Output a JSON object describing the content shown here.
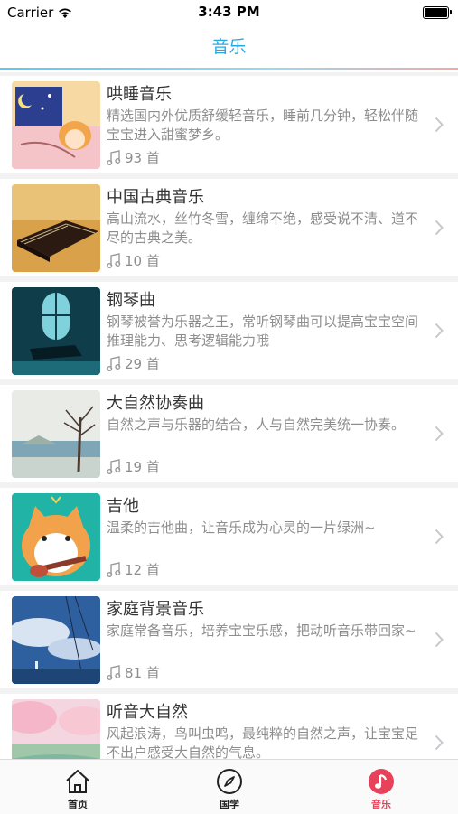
{
  "status": {
    "carrier": "Carrier",
    "time": "3:43 PM"
  },
  "header": {
    "title": "音乐"
  },
  "items": [
    {
      "name": "哄睡音乐",
      "desc": "精选国内外优质舒缓轻音乐，睡前几分钟，轻松伴随宝宝进入甜蜜梦乡。",
      "count": "93 首"
    },
    {
      "name": "中国古典音乐",
      "desc": "高山流水，丝竹冬雪，缠绵不绝，感受说不清、道不尽的古典之美。",
      "count": "10 首"
    },
    {
      "name": "钢琴曲",
      "desc": "钢琴被誉为乐器之王，常听钢琴曲可以提高宝宝空间推理能力、思考逻辑能力哦",
      "count": "29 首"
    },
    {
      "name": "大自然协奏曲",
      "desc": "自然之声与乐器的结合，人与自然完美统一协奏。",
      "count": "19 首"
    },
    {
      "name": "吉他",
      "desc": "温柔的吉他曲，让音乐成为心灵的一片绿洲~",
      "count": "12 首"
    },
    {
      "name": "家庭背景音乐",
      "desc": "家庭常备音乐，培养宝宝乐感，把动听音乐带回家~",
      "count": "81 首"
    },
    {
      "name": "听音大自然",
      "desc": "风起浪涛，鸟叫虫鸣，最纯粹的自然之声，让宝宝足不出户感受大自然的气息。",
      "count": ""
    }
  ],
  "tabs": [
    {
      "label": "首页",
      "icon": "home-icon"
    },
    {
      "label": "国学",
      "icon": "compass-icon"
    },
    {
      "label": "音乐",
      "icon": "music-note-icon"
    }
  ],
  "colors": {
    "accent": "#27a9e3",
    "active_tab": "#e8415a"
  }
}
